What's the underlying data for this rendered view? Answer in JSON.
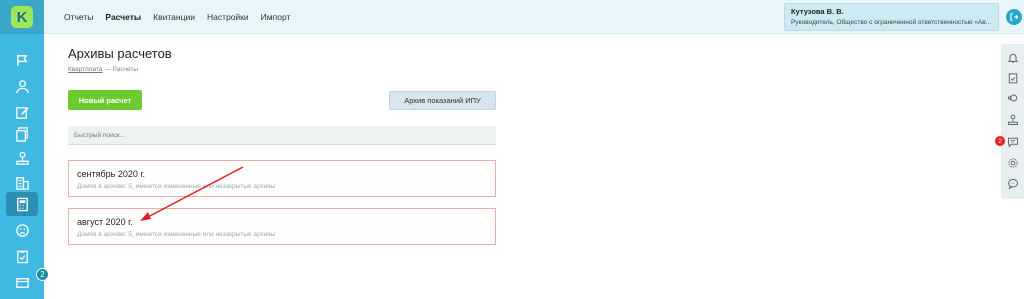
{
  "app": {
    "logo_letter": "K"
  },
  "topnav": {
    "tabs": [
      {
        "label": "Отчеты"
      },
      {
        "label": "Расчеты"
      },
      {
        "label": "Квитанции"
      },
      {
        "label": "Настройки"
      },
      {
        "label": "Импорт"
      }
    ],
    "active_index": 1
  },
  "user": {
    "name": "Кутузова В. В.",
    "role": "Руководитель, Общество с ограниченной ответственностью «Ав..."
  },
  "page": {
    "title": "Архивы расчетов",
    "breadcrumb_link": "Квартплата",
    "breadcrumb_sep": " — ",
    "breadcrumb_current": "Расчеты"
  },
  "actions": {
    "new_button": "Новый расчет",
    "archive_button": "Архив показаний ИПУ"
  },
  "search": {
    "placeholder": "Быстрый поиск..."
  },
  "archives": [
    {
      "title": "сентябрь 2020 г.",
      "subtitle": "Домов в архиве: 5, имеются измененные или незакрытые архивы"
    },
    {
      "title": "август 2020 г.",
      "subtitle": "Домов в архиве: 5, имеются измененные или незакрытые архивы"
    }
  ],
  "left_rail": {
    "badge": "2",
    "icons": [
      "flag-icon",
      "users-icon",
      "edit-icon",
      "documents-icon",
      "stamp-icon",
      "building-icon",
      "calculator-icon",
      "sad-face-icon",
      "clipboard-icon",
      "wallet-icon"
    ]
  },
  "right_rail": {
    "badge": "2",
    "icons": [
      "bell-icon",
      "clipboard-icon",
      "support-icon",
      "stamp-icon",
      "chat-icon",
      "gear-icon",
      "comment-icon"
    ]
  },
  "colors": {
    "rail": "#3fb9e2",
    "accent_green": "#6ccb2f",
    "card_border": "#f4a9a9",
    "arrow": "#e02020"
  }
}
